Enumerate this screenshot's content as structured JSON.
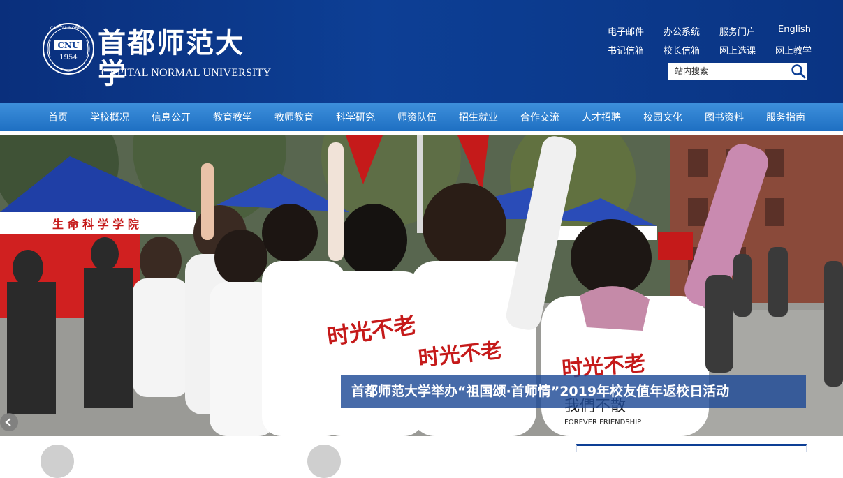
{
  "header": {
    "logo_cn": "首都师范大学",
    "logo_en": "CAPITAL NORMAL UNIVERSITY",
    "seal_text_top": "CAPITAL NORMAL",
    "seal_abbr": "CNU",
    "seal_year": "1954",
    "background_color": "#0d3f95"
  },
  "toplinks": [
    "电子邮件",
    "办公系统",
    "服务门户",
    "English",
    "书记信箱",
    "校长信箱",
    "网上选课",
    "网上教学"
  ],
  "search": {
    "placeholder": "站内搜索",
    "icon": "search-icon"
  },
  "nav": {
    "items": [
      "首页",
      "学校概况",
      "信息公开",
      "教育教学",
      "教师教育",
      "科学研究",
      "师资队伍",
      "招生就业",
      "合作交流",
      "人才招聘",
      "校园文化",
      "图书资料",
      "服务指南"
    ],
    "color": "#2a7fd0"
  },
  "banner": {
    "caption": "首都师范大学举办“祖国颂·首师情”2019年校友值年返校日活动",
    "prev_icon": "arrow-left-icon",
    "tent_sign": "生 命 科 学 学 院",
    "shirt_text": "时光不老",
    "shirt_text2": "我們不散",
    "shirt_text3": "FOREVER FRIENDSHIP"
  }
}
